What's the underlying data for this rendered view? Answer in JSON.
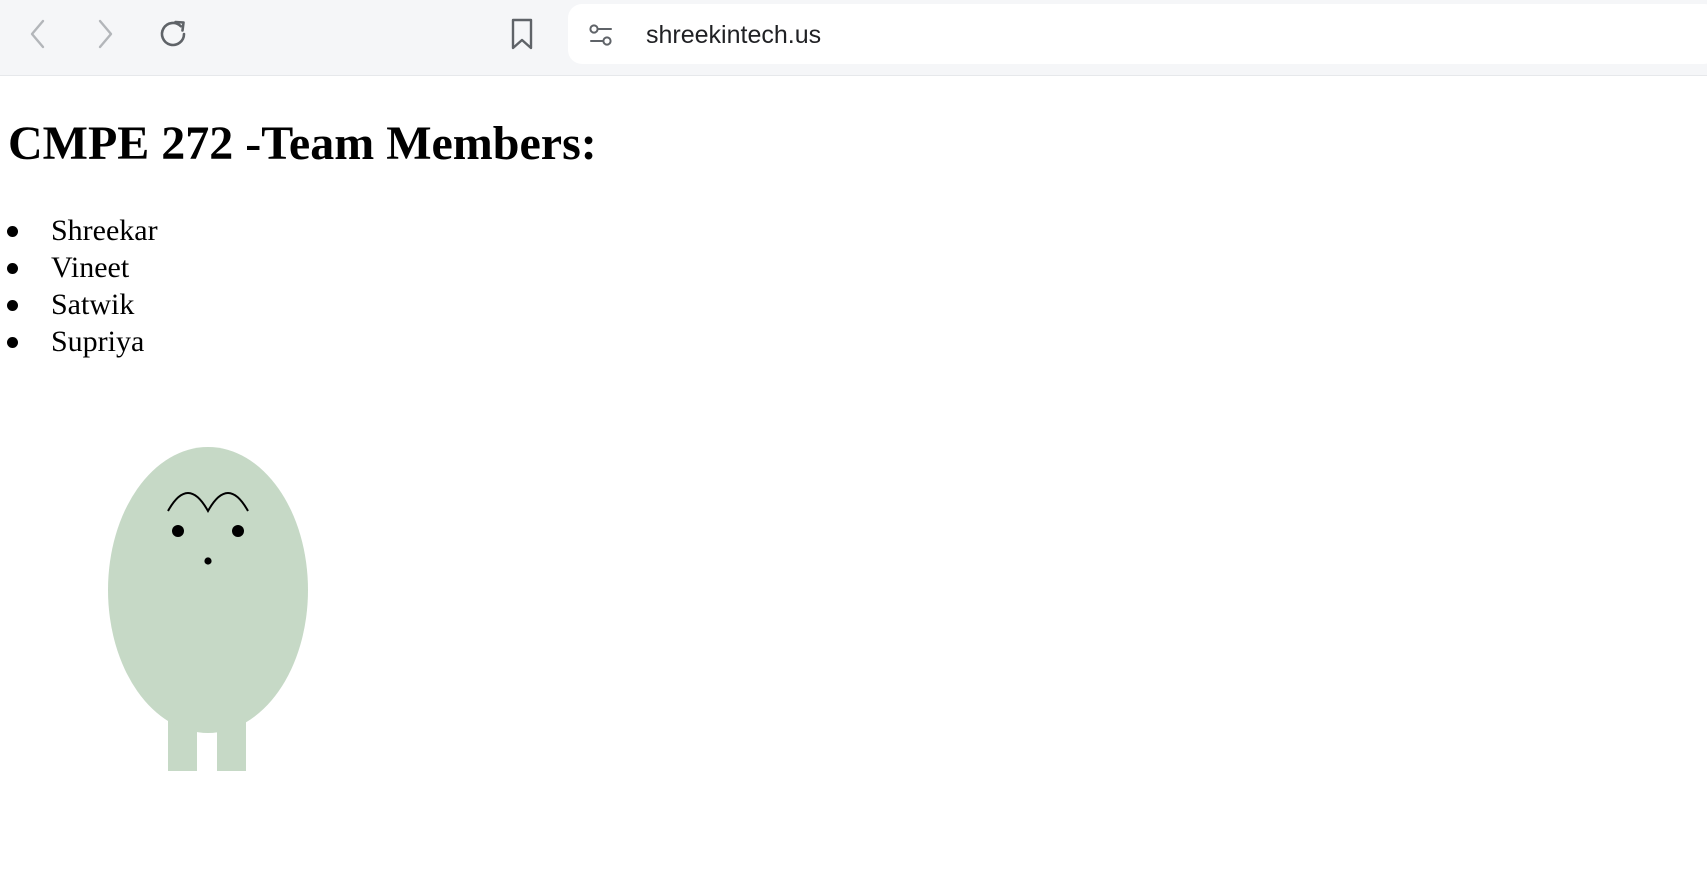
{
  "browser": {
    "url": "shreekintech.us",
    "icons": {
      "back": "chevron-left-icon",
      "forward": "chevron-right-icon",
      "reload": "reload-icon",
      "bookmark": "bookmark-icon",
      "site_settings": "tune-icon"
    }
  },
  "page": {
    "title": "CMPE 272 -Team Members:",
    "members": [
      "Shreekar",
      "Vineet",
      "Satwik",
      "Supriya"
    ]
  },
  "colors": {
    "toolbar_bg": "#f5f6f8",
    "creature_body": "#c6d9c6",
    "text": "#000000"
  }
}
